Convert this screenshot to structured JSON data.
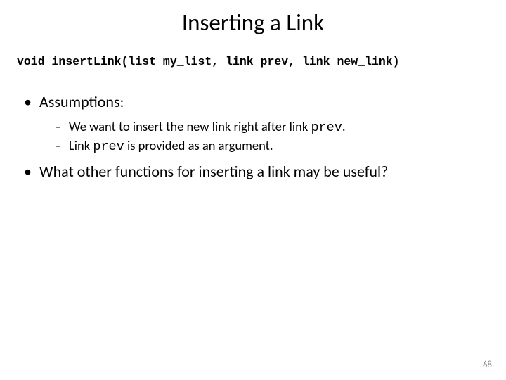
{
  "title": "Inserting a Link",
  "code": "void insertLink(list my_list, link prev, link new_link)",
  "bullets": {
    "b1": "Assumptions:",
    "sub1_pre": "We want to insert the new link right after link ",
    "sub1_code": "prev",
    "sub1_post": ".",
    "sub2_pre": "Link ",
    "sub2_code": "prev",
    "sub2_post": " is provided as an argument.",
    "b2": "What other functions for inserting a link may be useful?"
  },
  "pageNumber": "68"
}
